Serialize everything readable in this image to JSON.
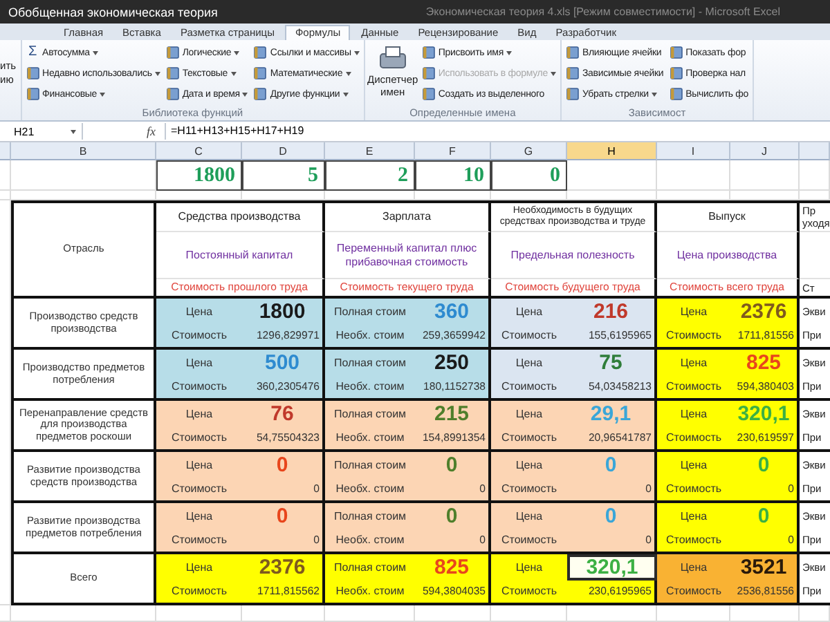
{
  "window": {
    "title": "Обобщенная экономическая теория",
    "document_title": "Экономическая теория 4.xls [Режим совместимости] - Microsoft Excel"
  },
  "ribbon_tabs": [
    {
      "label": "Главная",
      "selected": false
    },
    {
      "label": "Вставка",
      "selected": false
    },
    {
      "label": "Разметка страницы",
      "selected": false
    },
    {
      "label": "Формулы",
      "selected": true
    },
    {
      "label": "Данные",
      "selected": false
    },
    {
      "label": "Рецензирование",
      "selected": false
    },
    {
      "label": "Вид",
      "selected": false
    },
    {
      "label": "Разработчик",
      "selected": false
    }
  ],
  "ribbon": {
    "cut_button": [
      "ить",
      "ию"
    ],
    "groups": [
      {
        "label": "Библиотека функций",
        "columns": [
          [
            {
              "label": "Автосумма",
              "glyph": "Σ",
              "menu": true,
              "disabled": false
            },
            {
              "label": "Недавно использовались",
              "menu": true,
              "disabled": false
            },
            {
              "label": "Финансовые",
              "menu": true,
              "disabled": false
            }
          ],
          [
            {
              "label": "Логические",
              "menu": true,
              "disabled": false
            },
            {
              "label": "Текстовые",
              "menu": true,
              "disabled": false
            },
            {
              "label": "Дата и время",
              "menu": true,
              "disabled": false
            }
          ],
          [
            {
              "label": "Ссылки и массивы",
              "menu": true,
              "disabled": false
            },
            {
              "label": "Математические",
              "menu": true,
              "disabled": false
            },
            {
              "label": "Другие функции",
              "menu": true,
              "disabled": false
            }
          ]
        ]
      },
      {
        "label": "Определенные имена",
        "big_button": "Диспетчер имен",
        "columns": [
          [
            {
              "label": "Присвоить имя",
              "menu": true,
              "disabled": false
            },
            {
              "label": "Использовать в формуле",
              "menu": true,
              "disabled": true
            },
            {
              "label": "Создать из выделенного",
              "menu": false,
              "disabled": false
            }
          ]
        ]
      },
      {
        "label": "Зависимост",
        "columns": [
          [
            {
              "label": "Влияющие ячейки",
              "menu": false,
              "disabled": false
            },
            {
              "label": "Зависимые ячейки",
              "menu": false,
              "disabled": false
            },
            {
              "label": "Убрать стрелки",
              "menu": true,
              "disabled": false
            }
          ],
          [
            {
              "label": "Показать фор",
              "menu": false,
              "disabled": false
            },
            {
              "label": "Проверка нал",
              "menu": false,
              "disabled": false
            },
            {
              "label": "Вычислить фо",
              "menu": false,
              "disabled": false
            }
          ]
        ]
      }
    ]
  },
  "formula_bar": {
    "cell": "H21",
    "fx": "fx",
    "formula": "=H11+H13+H15+H17+H19"
  },
  "sheet": {
    "columns": [
      {
        "label": "B",
        "selected": false
      },
      {
        "label": "C",
        "selected": false
      },
      {
        "label": "D",
        "selected": false
      },
      {
        "label": "E",
        "selected": false
      },
      {
        "label": "F",
        "selected": false
      },
      {
        "label": "G",
        "selected": false
      },
      {
        "label": "H",
        "selected": true
      },
      {
        "label": "I",
        "selected": false
      },
      {
        "label": "J",
        "selected": false
      }
    ],
    "top_values": [
      "1800",
      "5",
      "2",
      "10",
      "0"
    ],
    "table": {
      "header": {
        "sector": "Отрасль",
        "groups": [
          {
            "title": "Средства производства",
            "subtitle": "Постоянный капитал",
            "labour": "Стоимость прошлого труда"
          },
          {
            "title": "Зарплата",
            "subtitle": "Переменный капитал плюс прибавочная стоимость",
            "labour": "Стоимость текущего труда"
          },
          {
            "title": "Необходимость в будущих средствах производства и труде",
            "subtitle": "Предельная полезность",
            "labour": "Стоимость будущего труда"
          },
          {
            "title": "Выпуск",
            "subtitle": "Цена производства",
            "labour": "Стоимость всего труда"
          }
        ],
        "cut_column": {
          "title": [
            "Пр",
            "уходя"
          ],
          "labour": "Ст"
        }
      },
      "rows": [
        {
          "sector": "Производство средств производства",
          "cut_column": [
            "Экви",
            "При"
          ],
          "blocks": [
            {
              "color": "#b7dde8",
              "price_label": "Цена",
              "price": {
                "text": "1800",
                "color": "#1a1a1a"
              },
              "cost_label": "Стоимость",
              "cost": "1296,829971",
              "selected": false
            },
            {
              "color": "#b7dde8",
              "price_label": "Полная стоим",
              "price": {
                "text": "360",
                "color": "#2e8bd0"
              },
              "cost_label": "Необх. стоим",
              "cost": "259,3659942",
              "selected": false
            },
            {
              "color": "#dbe5f1",
              "price_label": "Цена",
              "price": {
                "text": "216",
                "color": "#c0392b"
              },
              "cost_label": "Стоимость",
              "cost": "155,6195965",
              "selected": false
            },
            {
              "color": "#ffff00",
              "price_label": "Цена",
              "price": {
                "text": "2376",
                "color": "#7f5a1e"
              },
              "cost_label": "Стоимость",
              "cost": "1711,81556",
              "selected": false
            }
          ]
        },
        {
          "sector": "Производство предметов потребления",
          "cut_column": [
            "Экви",
            "При"
          ],
          "blocks": [
            {
              "color": "#b7dde8",
              "price_label": "Цена",
              "price": {
                "text": "500",
                "color": "#2e8bd0"
              },
              "cost_label": "Стоимость",
              "cost": "360,2305476",
              "selected": false
            },
            {
              "color": "#b7dde8",
              "price_label": "Полная стоим",
              "price": {
                "text": "250",
                "color": "#1a1a1a"
              },
              "cost_label": "Необх. стоим",
              "cost": "180,1152738",
              "selected": false
            },
            {
              "color": "#dbe5f1",
              "price_label": "Цена",
              "price": {
                "text": "75",
                "color": "#2f7d3a"
              },
              "cost_label": "Стоимость",
              "cost": "54,03458213",
              "selected": false
            },
            {
              "color": "#ffff00",
              "price_label": "Цена",
              "price": {
                "text": "825",
                "color": "#e8461c"
              },
              "cost_label": "Стоимость",
              "cost": "594,380403",
              "selected": false
            }
          ]
        },
        {
          "sector": "Перенаправление средств для производства предметов роскоши",
          "cut_column": [
            "Экви",
            "При"
          ],
          "blocks": [
            {
              "color": "#fcd5b4",
              "price_label": "Цена",
              "price": {
                "text": "76",
                "color": "#c0392b"
              },
              "cost_label": "Стоимость",
              "cost": "54,75504323",
              "selected": false
            },
            {
              "color": "#fcd5b4",
              "price_label": "Полная стоим",
              "price": {
                "text": "215",
                "color": "#4f7f2b"
              },
              "cost_label": "Необх. стоим",
              "cost": "154,8991354",
              "selected": false
            },
            {
              "color": "#fcd5b4",
              "price_label": "Цена",
              "price": {
                "text": "29,1",
                "color": "#3aa6d8"
              },
              "cost_label": "Стоимость",
              "cost": "20,96541787",
              "selected": false
            },
            {
              "color": "#ffff00",
              "price_label": "Цена",
              "price": {
                "text": "320,1",
                "color": "#3cb043"
              },
              "cost_label": "Стоимость",
              "cost": "230,619597",
              "selected": false
            }
          ]
        },
        {
          "sector": "Развитие производства средств производства",
          "cut_column": [
            "Экви",
            "При"
          ],
          "blocks": [
            {
              "color": "#fcd5b4",
              "price_label": "Цена",
              "price": {
                "text": "0",
                "color": "#e8461c"
              },
              "cost_label": "Стоимость",
              "cost": "0",
              "selected": false
            },
            {
              "color": "#fcd5b4",
              "price_label": "Полная стоим",
              "price": {
                "text": "0",
                "color": "#4f7f2b"
              },
              "cost_label": "Необх. стоим",
              "cost": "0",
              "selected": false
            },
            {
              "color": "#fcd5b4",
              "price_label": "Цена",
              "price": {
                "text": "0",
                "color": "#3aa6d8"
              },
              "cost_label": "Стоимость",
              "cost": "0",
              "selected": false
            },
            {
              "color": "#ffff00",
              "price_label": "Цена",
              "price": {
                "text": "0",
                "color": "#3cb043"
              },
              "cost_label": "Стоимость",
              "cost": "0",
              "selected": false
            }
          ]
        },
        {
          "sector": "Развитие производства предметов потребления",
          "cut_column": [
            "Экви",
            "При"
          ],
          "blocks": [
            {
              "color": "#fcd5b4",
              "price_label": "Цена",
              "price": {
                "text": "0",
                "color": "#e8461c"
              },
              "cost_label": "Стоимость",
              "cost": "0",
              "selected": false
            },
            {
              "color": "#fcd5b4",
              "price_label": "Полная стоим",
              "price": {
                "text": "0",
                "color": "#4f7f2b"
              },
              "cost_label": "Необх. стоим",
              "cost": "0",
              "selected": false
            },
            {
              "color": "#fcd5b4",
              "price_label": "Цена",
              "price": {
                "text": "0",
                "color": "#3aa6d8"
              },
              "cost_label": "Стоимость",
              "cost": "0",
              "selected": false
            },
            {
              "color": "#ffff00",
              "price_label": "Цена",
              "price": {
                "text": "0",
                "color": "#3cb043"
              },
              "cost_label": "Стоимость",
              "cost": "0",
              "selected": false
            }
          ]
        },
        {
          "sector": "Всего",
          "cut_column": [
            "Экви",
            "При"
          ],
          "blocks": [
            {
              "color": "#ffff00",
              "price_label": "Цена",
              "price": {
                "text": "2376",
                "color": "#7f5a1e"
              },
              "cost_label": "Стоимость",
              "cost": "1711,815562",
              "selected": false
            },
            {
              "color": "#ffff00",
              "price_label": "Полная стоим",
              "price": {
                "text": "825",
                "color": "#e8461c"
              },
              "cost_label": "Необх. стоим",
              "cost": "594,3804035",
              "selected": false
            },
            {
              "color": "#ffff00",
              "price_label": "Цена",
              "price": {
                "text": "320,1",
                "color": "#3cb043"
              },
              "cost_label": "Стоимость",
              "cost": "230,6195965",
              "selected": true
            },
            {
              "color": "#f9b233",
              "price_label": "Цена",
              "price": {
                "text": "3521",
                "color": "#2a1a0a"
              },
              "cost_label": "Стоимость",
              "cost": "2536,81556",
              "selected": false
            }
          ]
        }
      ]
    }
  }
}
